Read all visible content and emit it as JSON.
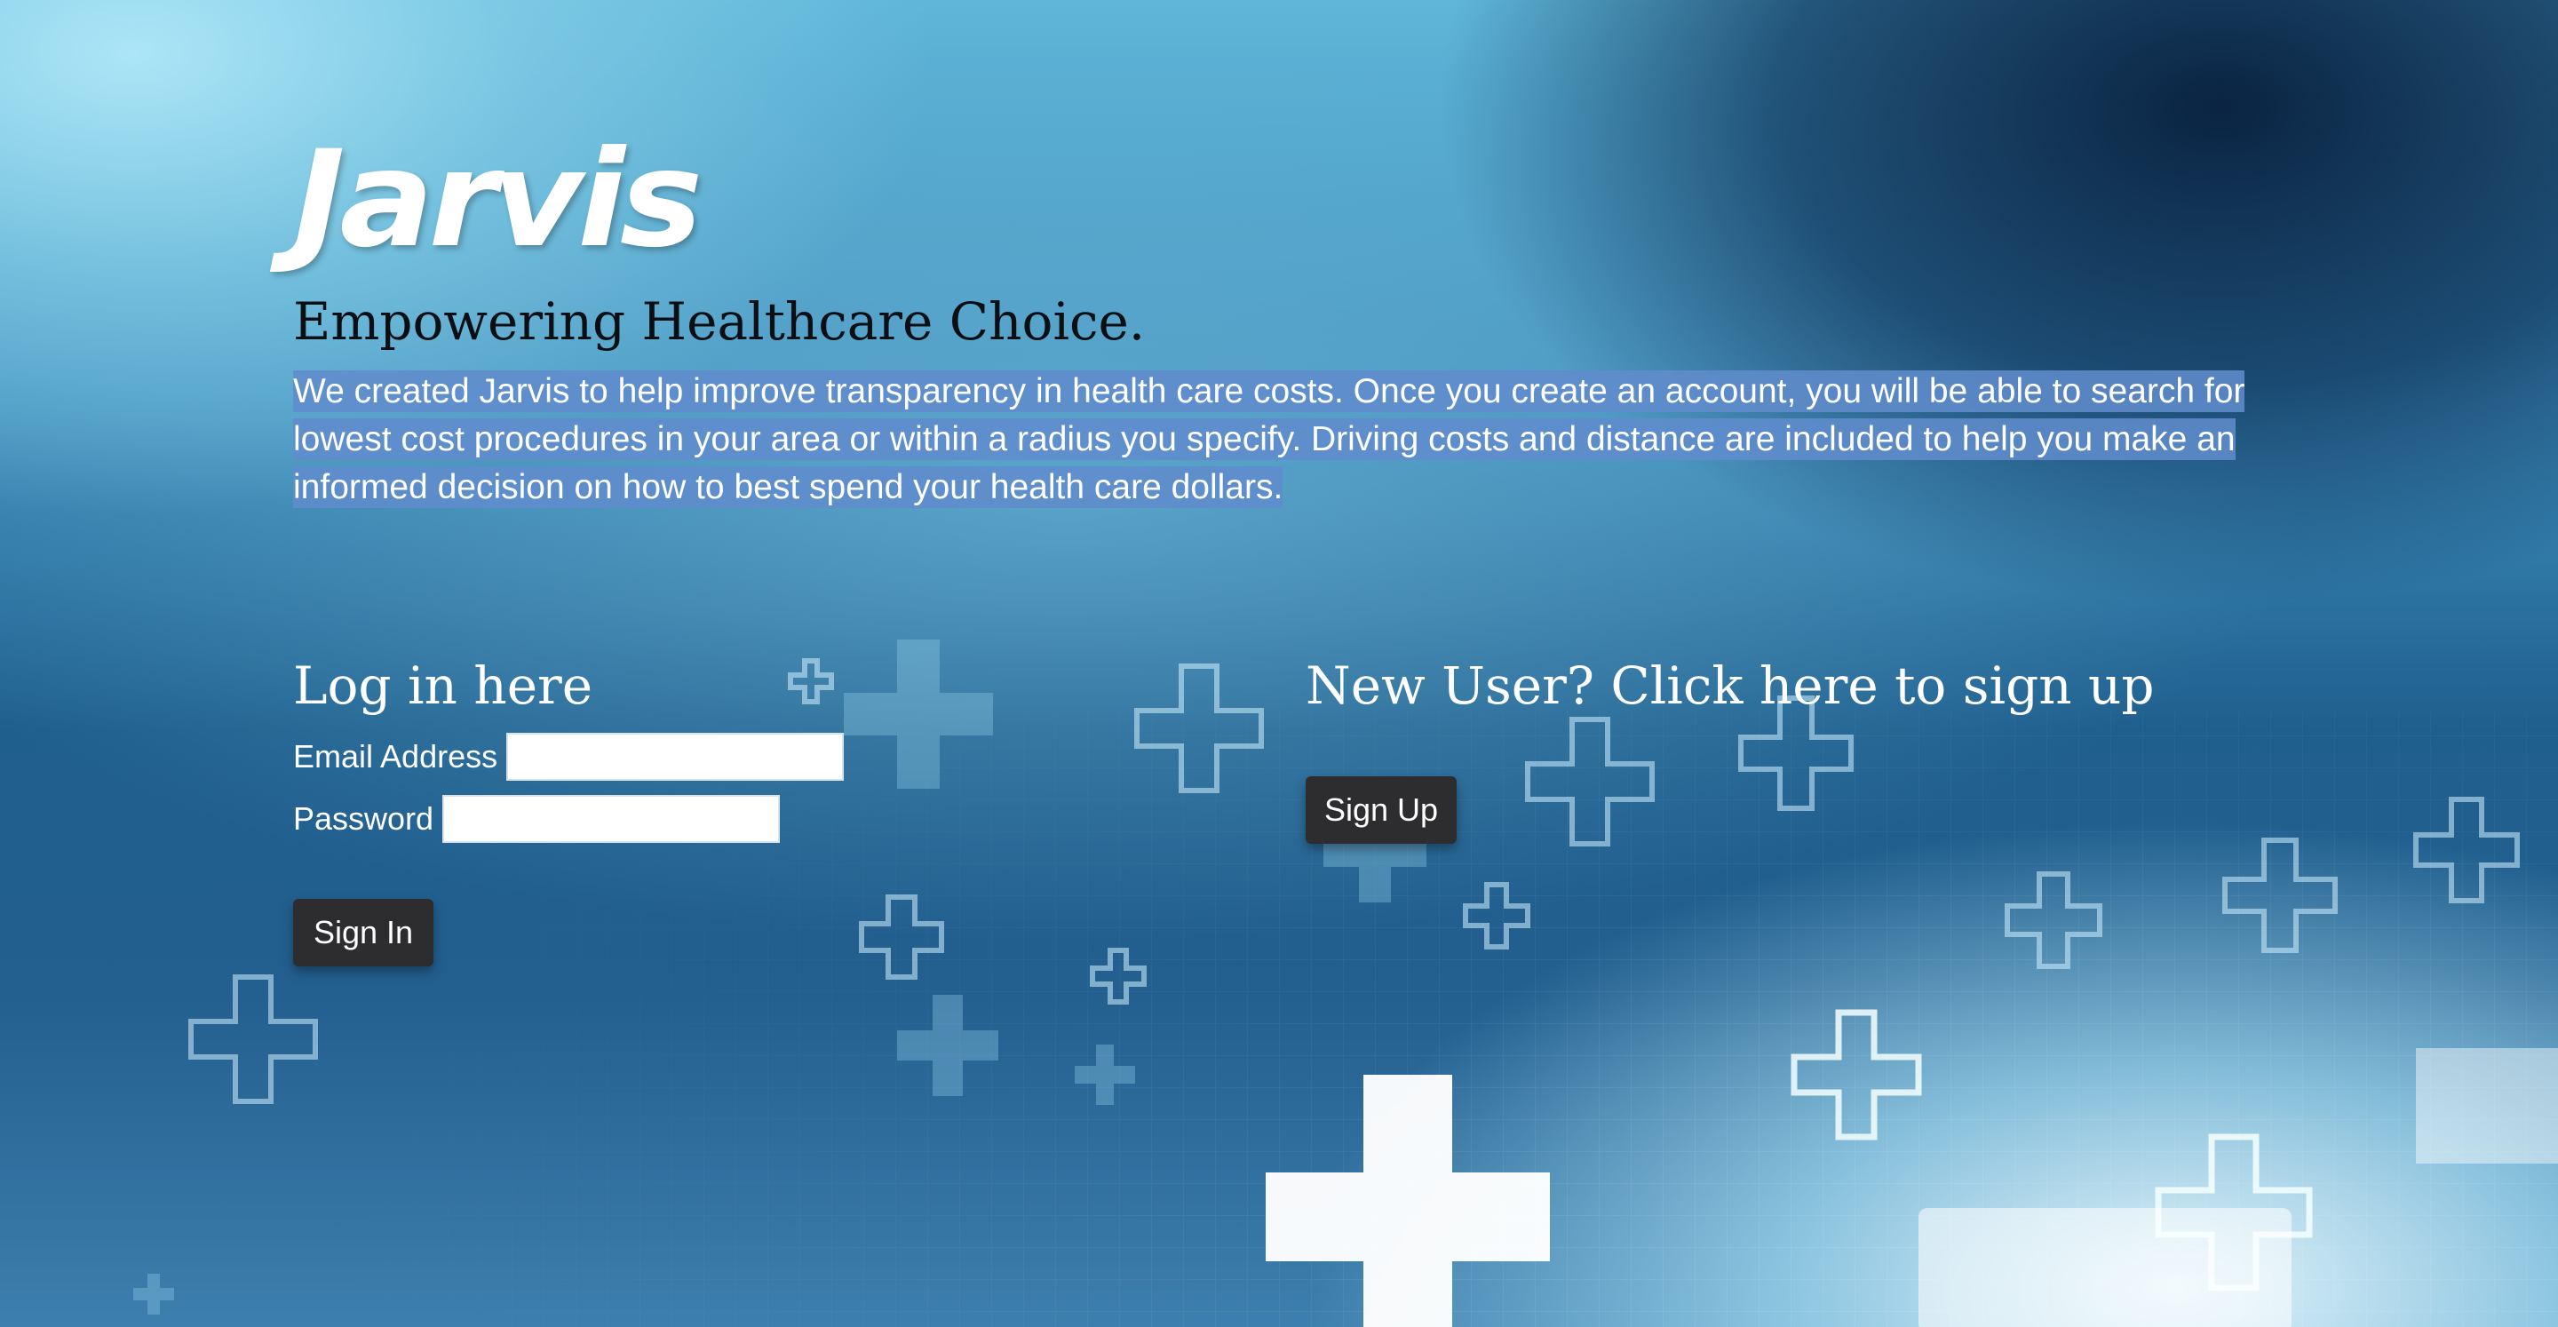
{
  "brand": {
    "logo_text": "Jarvis"
  },
  "hero": {
    "tagline": "Empowering Healthcare Choice.",
    "description": "We created Jarvis to help improve transparency in health care costs. Once you create an account, you will be able to search for lowest cost procedures in your area or within a radius you specify. Driving costs and distance are included to help you make an informed decision on how to best spend your health care dollars."
  },
  "login": {
    "title": "Log in here",
    "email_label": "Email Address",
    "email_value": "",
    "password_label": "Password",
    "password_value": "",
    "submit_label": "Sign In"
  },
  "signup": {
    "title": "New User? Click here to sign up",
    "button_label": "Sign Up"
  },
  "colors": {
    "button_bg": "#2d2d2f",
    "text_selection_highlight": "#608ccc",
    "tagline_text": "#0b0f14"
  }
}
